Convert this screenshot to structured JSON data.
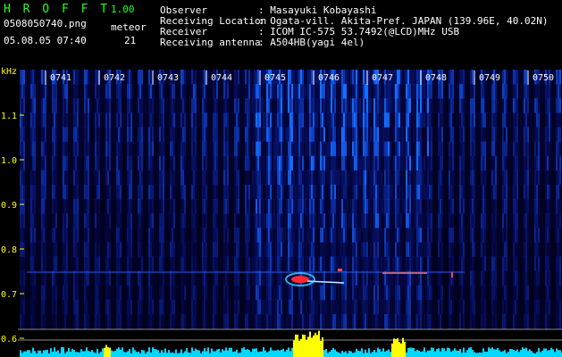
{
  "header": {
    "app_name": "H R O F F T",
    "version": "1.00",
    "filename": "0508050740.png",
    "datetime": "05.08.05 07:40",
    "meteor_label": "meteor",
    "meteor_count": "21"
  },
  "info": [
    {
      "label": "Observer",
      "value": ": Masayuki Kobayashi"
    },
    {
      "label": "Receiving Location",
      "value": ": Ogata-vill. Akita-Pref. JAPAN (139.96E, 40.02N)"
    },
    {
      "label": "Receiver",
      "value": ": ICOM IC-575 53.7492(@LCD)MHz USB"
    },
    {
      "label": "Receiving antenna",
      "value": ": A504HB(yagi 4el)"
    }
  ],
  "axis": {
    "unit": "kHz",
    "y_ticks": [
      "1.1",
      "1.0",
      "0.9",
      "0.8",
      "0.7",
      "0.6"
    ],
    "time_ticks": [
      "0741",
      "0742",
      "0743",
      "0744",
      "0745",
      "0746",
      "0747",
      "0748",
      "0749",
      "0750"
    ]
  },
  "colors": {
    "background": "#000000",
    "label_green": "#22ff22",
    "label_yellow": "#ffff00",
    "spectrum_blue": "#1a4cff",
    "echo_red": "#ff3030",
    "baseline_cyan": "#00e5ff"
  }
}
